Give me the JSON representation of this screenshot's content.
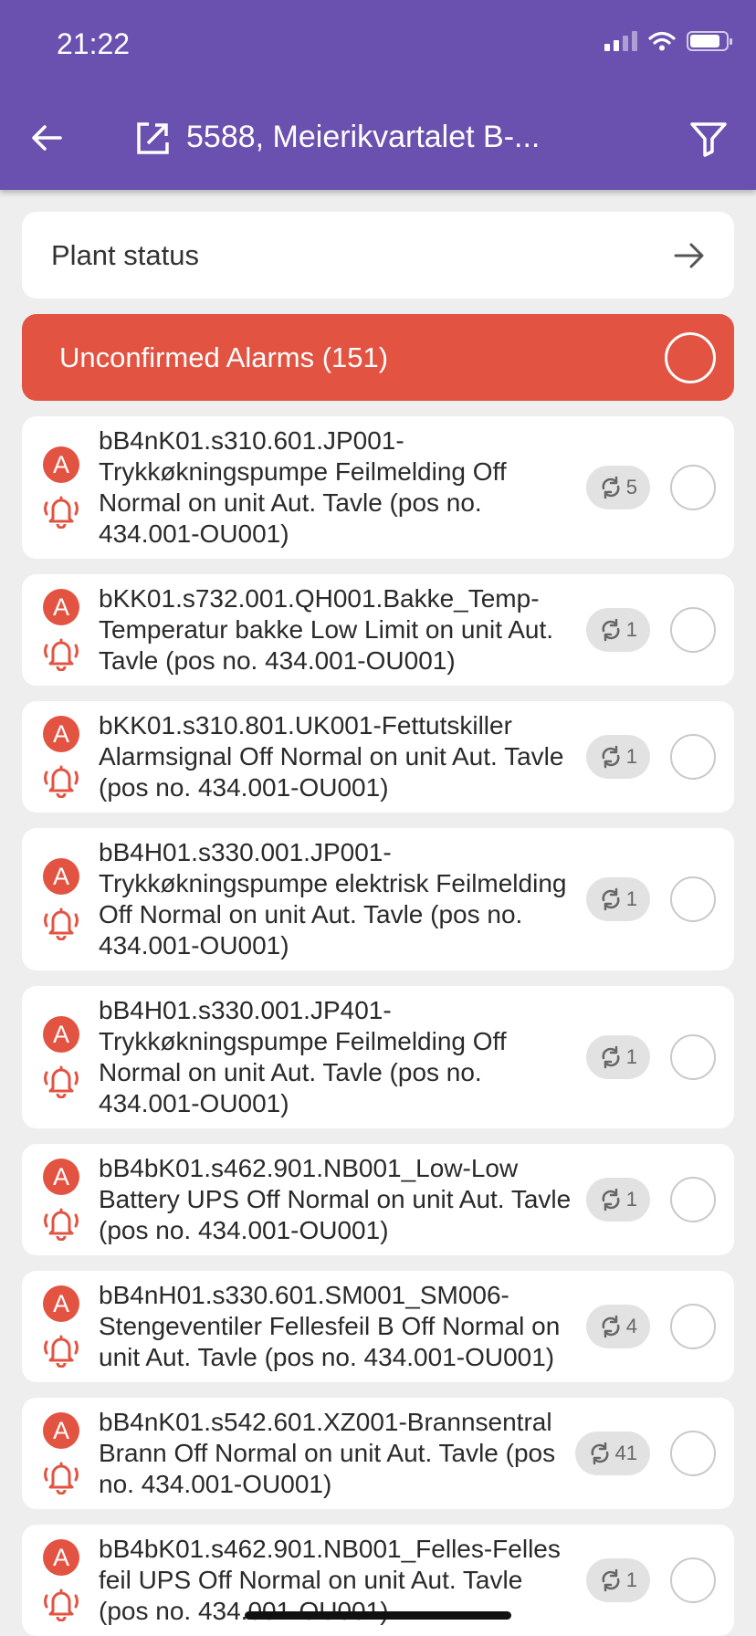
{
  "status_bar": {
    "time": "21:22"
  },
  "header": {
    "title": "5588, Meierikvartalet B-..."
  },
  "plant_status": {
    "label": "Plant status"
  },
  "unconfirmed": {
    "label": "Unconfirmed Alarms (151)"
  },
  "alarms": [
    {
      "badge": "A",
      "text": "bB4nK01.s310.601.JP001-Trykkøkningspumpe Feilmelding Off Normal on unit Aut. Tavle (pos no. 434.001-OU001)",
      "count": "5"
    },
    {
      "badge": "A",
      "text": "bKK01.s732.001.QH001.Bakke_Temp-Temperatur bakke Low Limit on unit Aut. Tavle (pos no. 434.001-OU001)",
      "count": "1"
    },
    {
      "badge": "A",
      "text": "bKK01.s310.801.UK001-Fettutskiller Alarmsignal Off Normal on unit Aut. Tavle (pos no. 434.001-OU001)",
      "count": "1"
    },
    {
      "badge": "A",
      "text": "bB4H01.s330.001.JP001-Trykkøkningspumpe elektrisk Feilmelding Off Normal on unit Aut. Tavle (pos no. 434.001-OU001)",
      "count": "1"
    },
    {
      "badge": "A",
      "text": "bB4H01.s330.001.JP401-Trykkøkningspumpe Feilmelding Off Normal on unit Aut. Tavle (pos no. 434.001-OU001)",
      "count": "1"
    },
    {
      "badge": "A",
      "text": "bB4bK01.s462.901.NB001_Low-Low Battery UPS Off Normal on unit Aut. Tavle (pos no. 434.001-OU001)",
      "count": "1"
    },
    {
      "badge": "A",
      "text": "bB4nH01.s330.601.SM001_SM006-Stengeventiler Fellesfeil B Off Normal on unit Aut. Tavle (pos no. 434.001-OU001)",
      "count": "4"
    },
    {
      "badge": "A",
      "text": "bB4nK01.s542.601.XZ001-Brannsentral Brann Off Normal on unit Aut. Tavle (pos no. 434.001-OU001)",
      "count": "41"
    },
    {
      "badge": "A",
      "text": "bB4bK01.s462.901.NB001_Felles-Felles feil UPS Off Normal on unit Aut. Tavle (pos no. 434.001-OU001)",
      "count": "1"
    }
  ],
  "colors": {
    "appbar": "#6a51af",
    "alarm_red": "#e25342",
    "background": "#eeeeee"
  }
}
